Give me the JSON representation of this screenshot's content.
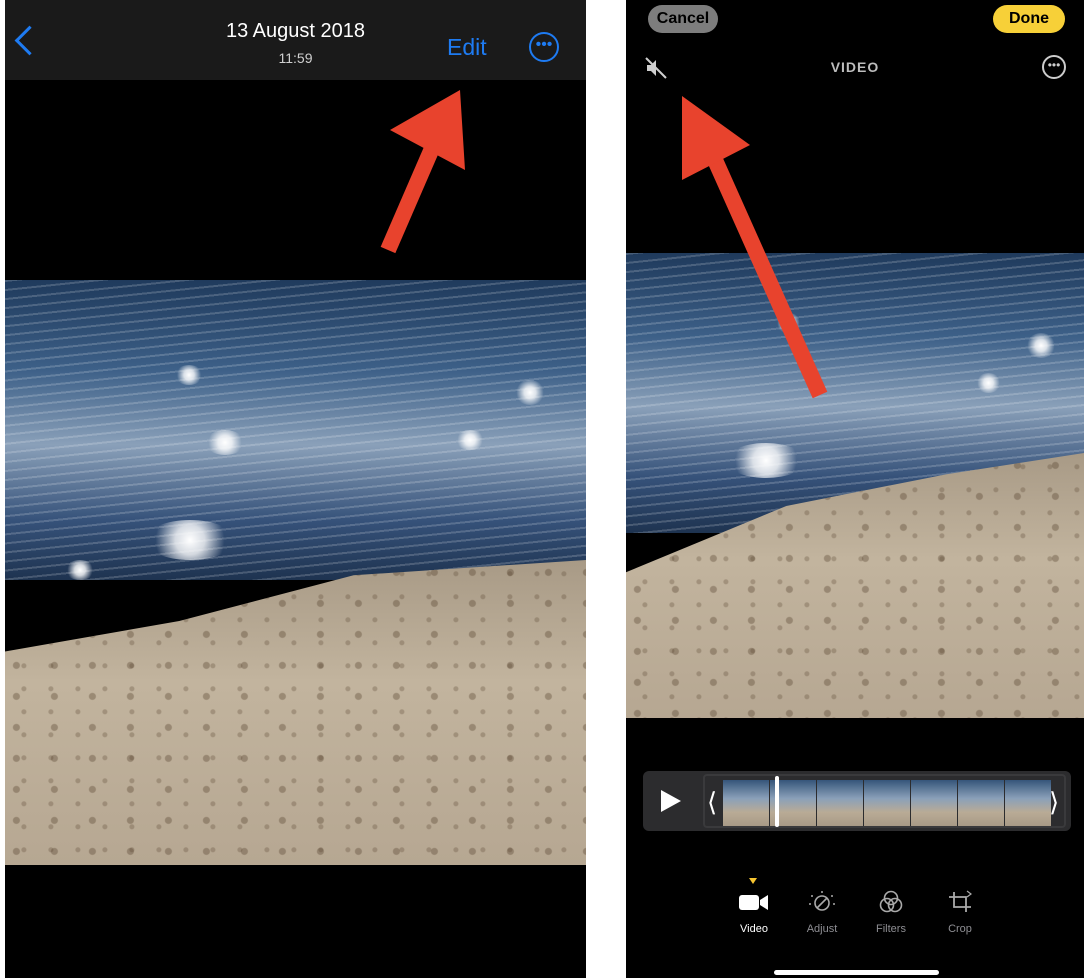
{
  "left_screen": {
    "header": {
      "date": "13 August 2018",
      "time": "11:59",
      "edit_label": "Edit"
    },
    "icons": [
      "back-chevron-icon",
      "more-options-icon"
    ],
    "accent_color": "#1e7bf2"
  },
  "right_screen": {
    "header": {
      "cancel_label": "Cancel",
      "done_label": "Done",
      "mode_label": "VIDEO"
    },
    "icons": [
      "speaker-muted-icon",
      "more-options-icon",
      "play-icon"
    ],
    "toolbar": [
      {
        "label": "Video",
        "icon": "video-camera-icon",
        "active": true
      },
      {
        "label": "Adjust",
        "icon": "adjust-dial-icon",
        "active": false
      },
      {
        "label": "Filters",
        "icon": "filters-circles-icon",
        "active": false
      },
      {
        "label": "Crop",
        "icon": "crop-icon",
        "active": false
      }
    ],
    "done_color": "#f7d038",
    "playhead_position": 0.17
  },
  "annotations": {
    "arrow_color": "#e8432d"
  }
}
